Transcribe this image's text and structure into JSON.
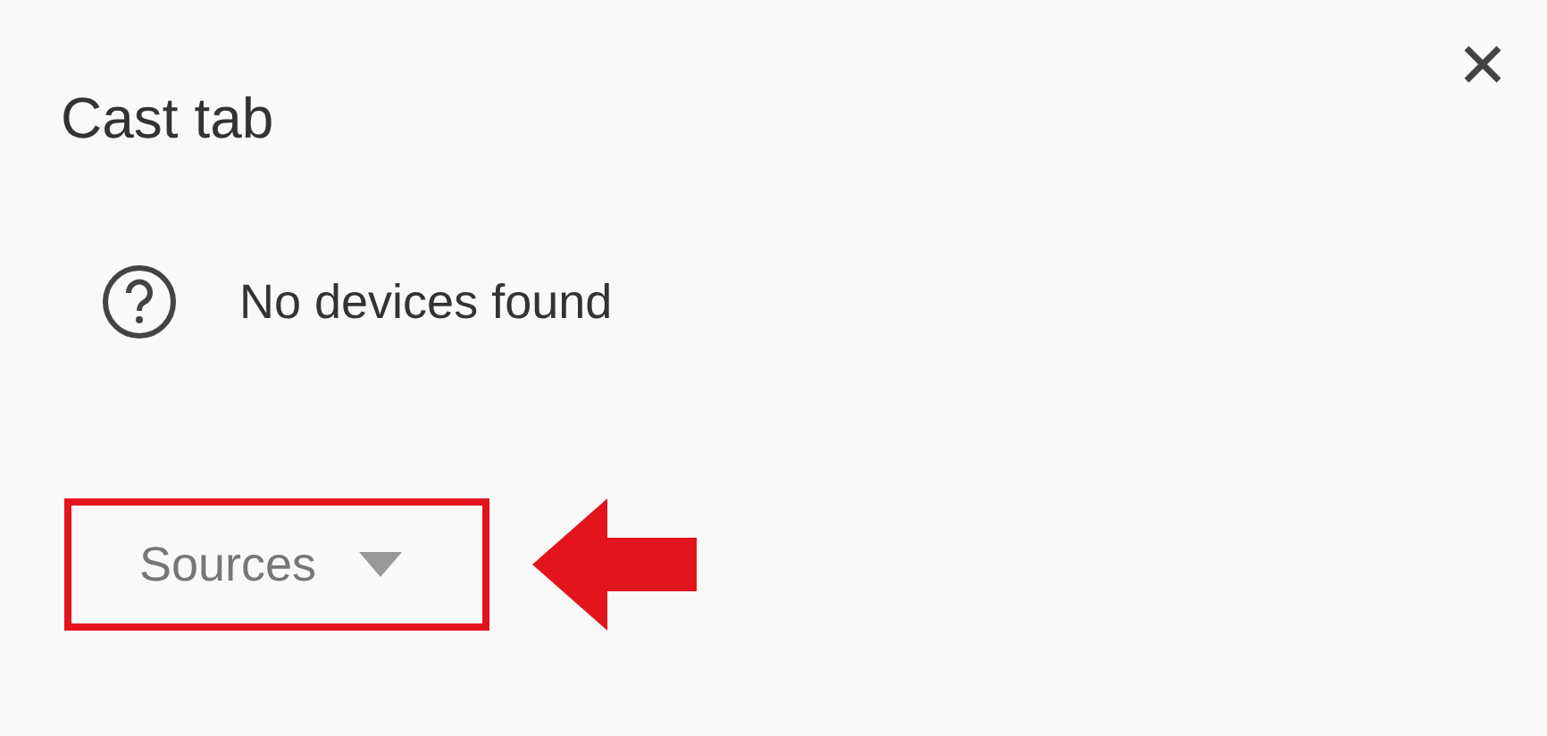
{
  "dialog": {
    "title": "Cast tab"
  },
  "status": {
    "message": "No devices found"
  },
  "sources_button": {
    "label": "Sources"
  }
}
